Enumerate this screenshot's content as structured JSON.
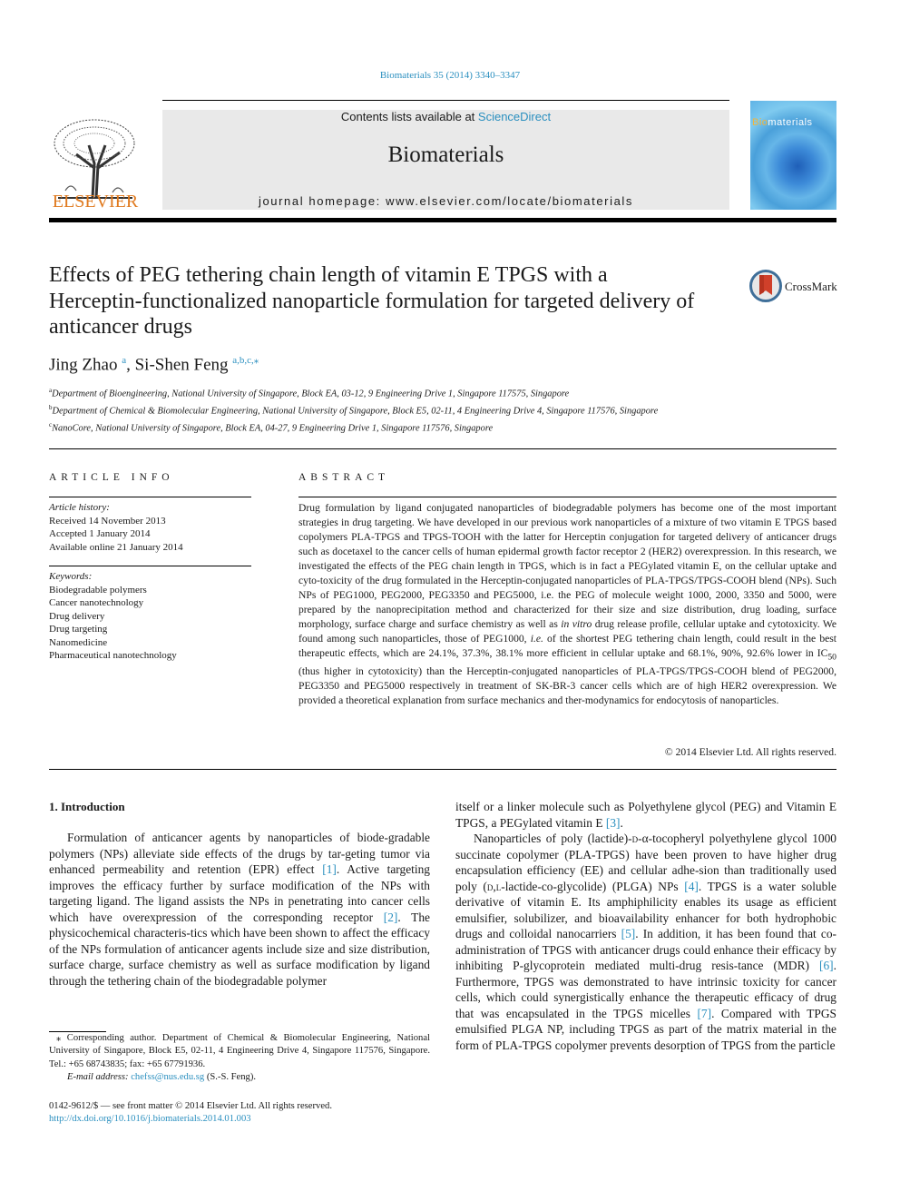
{
  "header": {
    "citation": "Biomaterials 35 (2014) 3340–3347",
    "contents_prefix": "Contents lists available at ",
    "contents_link": "ScienceDirect",
    "journal_name": "Biomaterials",
    "homepage": "journal homepage: www.elsevier.com/locate/biomaterials",
    "publisher_logo_text": "ELSEVIER",
    "cover_title_accent": "Bio",
    "cover_title_rest": "materials"
  },
  "article": {
    "title": "Effects of PEG tethering chain length of vitamin E TPGS with a Herceptin-functionalized nanoparticle formulation for targeted delivery of anticancer drugs",
    "crossmark_label": "CrossMark",
    "authors": [
      {
        "name": "Jing Zhao",
        "marks": "a"
      },
      {
        "name": "Si-Shen Feng",
        "marks": "a,b,c,⁎"
      }
    ],
    "affiliations": [
      {
        "mark": "a",
        "text": "Department of Bioengineering, National University of Singapore, Block EA, 03-12, 9 Engineering Drive 1, Singapore 117575, Singapore"
      },
      {
        "mark": "b",
        "text": "Department of Chemical & Biomolecular Engineering, National University of Singapore, Block E5, 02-11, 4 Engineering Drive 4, Singapore 117576, Singapore"
      },
      {
        "mark": "c",
        "text": "NanoCore, National University of Singapore, Block EA, 04-27, 9 Engineering Drive 1, Singapore 117576, Singapore"
      }
    ]
  },
  "article_info": {
    "heading": "ARTICLE INFO",
    "history_label": "Article history:",
    "history": [
      "Received 14 November 2013",
      "Accepted 1 January 2014",
      "Available online 21 January 2014"
    ],
    "keywords_label": "Keywords:",
    "keywords": [
      "Biodegradable polymers",
      "Cancer nanotechnology",
      "Drug delivery",
      "Drug targeting",
      "Nanomedicine",
      "Pharmaceutical nanotechnology"
    ]
  },
  "abstract": {
    "heading": "ABSTRACT",
    "part1": "Drug formulation by ligand conjugated nanoparticles of biodegradable polymers has become one of the most important strategies in drug targeting. We have developed in our previous work nanoparticles of a mixture of two vitamin E TPGS based copolymers PLA-TPGS and TPGS-TOOH with the latter for Herceptin conjugation for targeted delivery of anticancer drugs such as docetaxel to the cancer cells of human epidermal growth factor receptor 2 (HER2) overexpression. In this research, we investigated the effects of the PEG chain length in TPGS, which is in fact a PEGylated vitamin E, on the cellular uptake and cyto-toxicity of the drug formulated in the Herceptin-conjugated nanoparticles of PLA-TPGS/TPGS-COOH blend (NPs). Such NPs of PEG1000, PEG2000, PEG3350 and PEG5000, i.e. the PEG of molecule weight 1000, 2000, 3350 and 5000, were prepared by the nanoprecipitation method and characterized for their size and size distribution, drug loading, surface morphology, surface charge and surface chemistry as well as ",
    "italic1": "in vitro",
    "part2": " drug release profile, cellular uptake and cytotoxicity. We found among such nanoparticles, those of PEG1000, ",
    "italic2": "i.e.",
    "part3": " of the shortest PEG tethering chain length, could result in the best therapeutic effects, which are 24.1%, 37.3%, 38.1% more efficient in cellular uptake and 68.1%, 90%, 92.6% lower in IC",
    "sub": "50",
    "part4": " (thus higher in cytotoxicity) than the Herceptin-conjugated nanoparticles of PLA-TPGS/TPGS-COOH blend of PEG2000, PEG3350 and PEG5000 respectively in treatment of SK-BR-3 cancer cells which are of high HER2 overexpression. We provided a theoretical explanation from surface mechanics and ther-modynamics for endocytosis of nanoparticles.",
    "copyright": "© 2014 Elsevier Ltd. All rights reserved."
  },
  "intro": {
    "heading": "1.  Introduction",
    "col1_a": "Formulation of anticancer agents by nanoparticles of biode-gradable polymers (NPs) alleviate side effects of the drugs by tar-geting tumor via enhanced permeability and retention (EPR) effect ",
    "ref1": "[1]",
    "col1_b": ". Active targeting improves the efficacy further by surface modification of the NPs with targeting ligand. The ligand assists the NPs in penetrating into cancer cells which have overexpression of the corresponding receptor ",
    "ref2": "[2]",
    "col1_c": ". The physicochemical characteris-tics which have been shown to affect the efficacy of the NPs formulation of anticancer agents include size and size distribution, surface charge, surface chemistry as well as surface modification by ligand through the tethering chain of the biodegradable polymer",
    "col2_p1": "itself or a linker molecule such as Polyethylene glycol (PEG) and Vitamin E TPGS, a PEGylated vitamin E ",
    "ref3": "[3]",
    "col2_p2_a": "Nanoparticles of poly (lactide)-",
    "col2_p2_d": "d",
    "col2_p2_b": "-α-tocopheryl polyethylene glycol 1000 succinate copolymer (PLA-TPGS) have been proven to have higher drug encapsulation efficiency (EE) and cellular adhe-sion than traditionally used poly (",
    "col2_p2_dl": "d,l",
    "col2_p2_c": "-lactide-co-glycolide) (PLGA) NPs ",
    "ref4": "[4]",
    "col2_p2_e": ". TPGS is a water soluble derivative of vitamin E. Its amphiphilicity enables its usage as efficient emulsifier, solubilizer, and bioavailability enhancer for both hydrophobic drugs and colloidal nanocarriers ",
    "ref5": "[5]",
    "col2_p2_f": ". In addition, it has been found that co-administration of TPGS with anticancer drugs could enhance their efficacy by inhibiting P-glycoprotein mediated multi-drug resis-tance (MDR) ",
    "ref6": "[6]",
    "col2_p2_g": ". Furthermore, TPGS was demonstrated to have intrinsic toxicity for cancer cells, which could synergistically enhance the therapeutic efficacy of drug that was encapsulated in the TPGS micelles ",
    "ref7": "[7]",
    "col2_p2_h": ". Compared with TPGS emulsified PLGA NP, including TPGS as part of the matrix material in the form of PLA-TPGS copolymer prevents desorption of TPGS from the particle"
  },
  "footnote": {
    "corresponding": "⁎ Corresponding author. Department of Chemical & Biomolecular Engineering, National University of Singapore, Block E5, 02-11, 4 Engineering Drive 4, Singapore 117576, Singapore. Tel.: +65 68743835; fax: +65 67791936.",
    "email_label": "E-mail address: ",
    "email": "chefss@nus.edu.sg",
    "email_suffix": " (S.-S. Feng).",
    "issn": "0142-9612/$ — see front matter © 2014 Elsevier Ltd. All rights reserved.",
    "doi": "http://dx.doi.org/10.1016/j.biomaterials.2014.01.003"
  }
}
